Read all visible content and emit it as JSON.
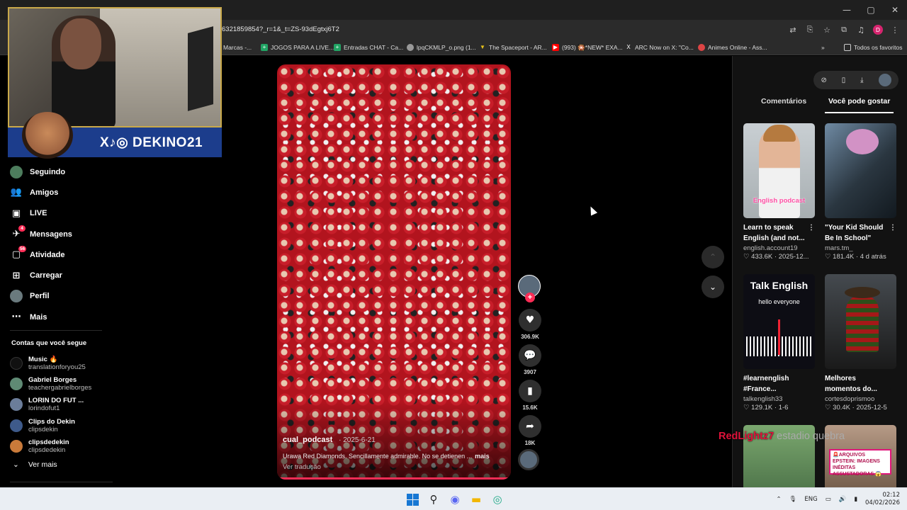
{
  "browser": {
    "url": "6321859854?_r=1&_t=ZS-93dEgtxj6T2",
    "window_controls": [
      "—",
      "▢",
      "✕"
    ],
    "bookmarks": [
      {
        "label": "Marcas -..."
      },
      {
        "label": "JOGOS PARA A LIVE..."
      },
      {
        "label": "Entradas CHAT - Ca..."
      },
      {
        "label": "lpqCKMLP_o.png (1..."
      },
      {
        "label": "The Spaceport - AR..."
      },
      {
        "label": "(993) 🎇*NEW* EXA..."
      },
      {
        "label": "ARC Now on X: \"Co..."
      },
      {
        "label": "Animes Online - Ass..."
      }
    ],
    "bookmarks_overflow": "»",
    "all_favorites": "Todos os favoritos",
    "profile_initial": "D"
  },
  "stream": {
    "handle": "DEKINO21",
    "social_icons": "X♪◎"
  },
  "sidebar": {
    "items": [
      {
        "label": "Seguindo",
        "icon": "following-avatar-icon"
      },
      {
        "label": "Amigos",
        "icon": "friends-icon"
      },
      {
        "label": "LIVE",
        "icon": "live-icon"
      },
      {
        "label": "Mensagens",
        "icon": "messages-icon",
        "badge": "4"
      },
      {
        "label": "Atividade",
        "icon": "activity-icon",
        "badge": "56"
      },
      {
        "label": "Carregar",
        "icon": "upload-icon"
      },
      {
        "label": "Perfil",
        "icon": "profile-avatar-icon"
      },
      {
        "label": "Mais",
        "icon": "more-icon"
      }
    ],
    "following_title": "Contas que você segue",
    "following": [
      {
        "name": "Music 🔥",
        "handle": "translationforyou25"
      },
      {
        "name": "Gabriel Borges",
        "handle": "teachergabrielborges"
      },
      {
        "name": "LORIN DO FUT ...",
        "handle": "lorindofut1"
      },
      {
        "name": "Clips do Dekin",
        "handle": "clipsdekin"
      },
      {
        "name": "clipsdedekin",
        "handle": "clipsdedekin"
      }
    ],
    "see_more": "Ver mais"
  },
  "video": {
    "author": "cual_podcast",
    "date": "2025-6-21",
    "caption": "Urawa Red Diamonds. Sencillamente admirable. No se detienen ...",
    "caption_more": "mais",
    "translation": "Ver tradução",
    "progress": 1.0,
    "actions": {
      "likes": "306.9K",
      "comments": "3907",
      "saves": "15.6K",
      "shares": "18K"
    }
  },
  "right_panel": {
    "tabs": [
      "Comentários",
      "Você pode gostar"
    ],
    "active_tab": "Você pode gostar",
    "cards": [
      {
        "title": "Learn to speak English (and not...",
        "author": "english.account19",
        "likes": "433.6K",
        "date": "2025-12...",
        "thumb_text": "English podcast"
      },
      {
        "title": "\"Your Kid Should Be In School\"",
        "author": "mars.tm_",
        "likes": "181.4K",
        "date": "4 d atrás",
        "thumb_text": ""
      },
      {
        "title": "#learnenglish #France...",
        "author": "talkenglish33",
        "likes": "129.1K",
        "date": "1-6",
        "thumb_text": "Talk English",
        "thumb_sub": "hello everyone"
      },
      {
        "title": "Melhores momentos do...",
        "author": "cortesdoprismoo",
        "likes": "30.4K",
        "date": "2025-12-5",
        "thumb_text": ""
      },
      {
        "title": "",
        "author": "",
        "likes": "",
        "date": "",
        "thumb_text": ""
      },
      {
        "title": "",
        "author": "",
        "likes": "",
        "date": "",
        "thumb_text": "🚨ARQUIVOS EPSTEIN: IMAGENS INÉDITAS ASSUSTADORAS 😱"
      }
    ]
  },
  "overlay_text": {
    "name": "RedLightz7",
    "message": "estadio quebra"
  },
  "taskbar": {
    "lang": "ENG",
    "time": "02:12",
    "date": "04/02/2026"
  },
  "colors": {
    "accent": "#fe2c55",
    "panel": "#121212"
  }
}
